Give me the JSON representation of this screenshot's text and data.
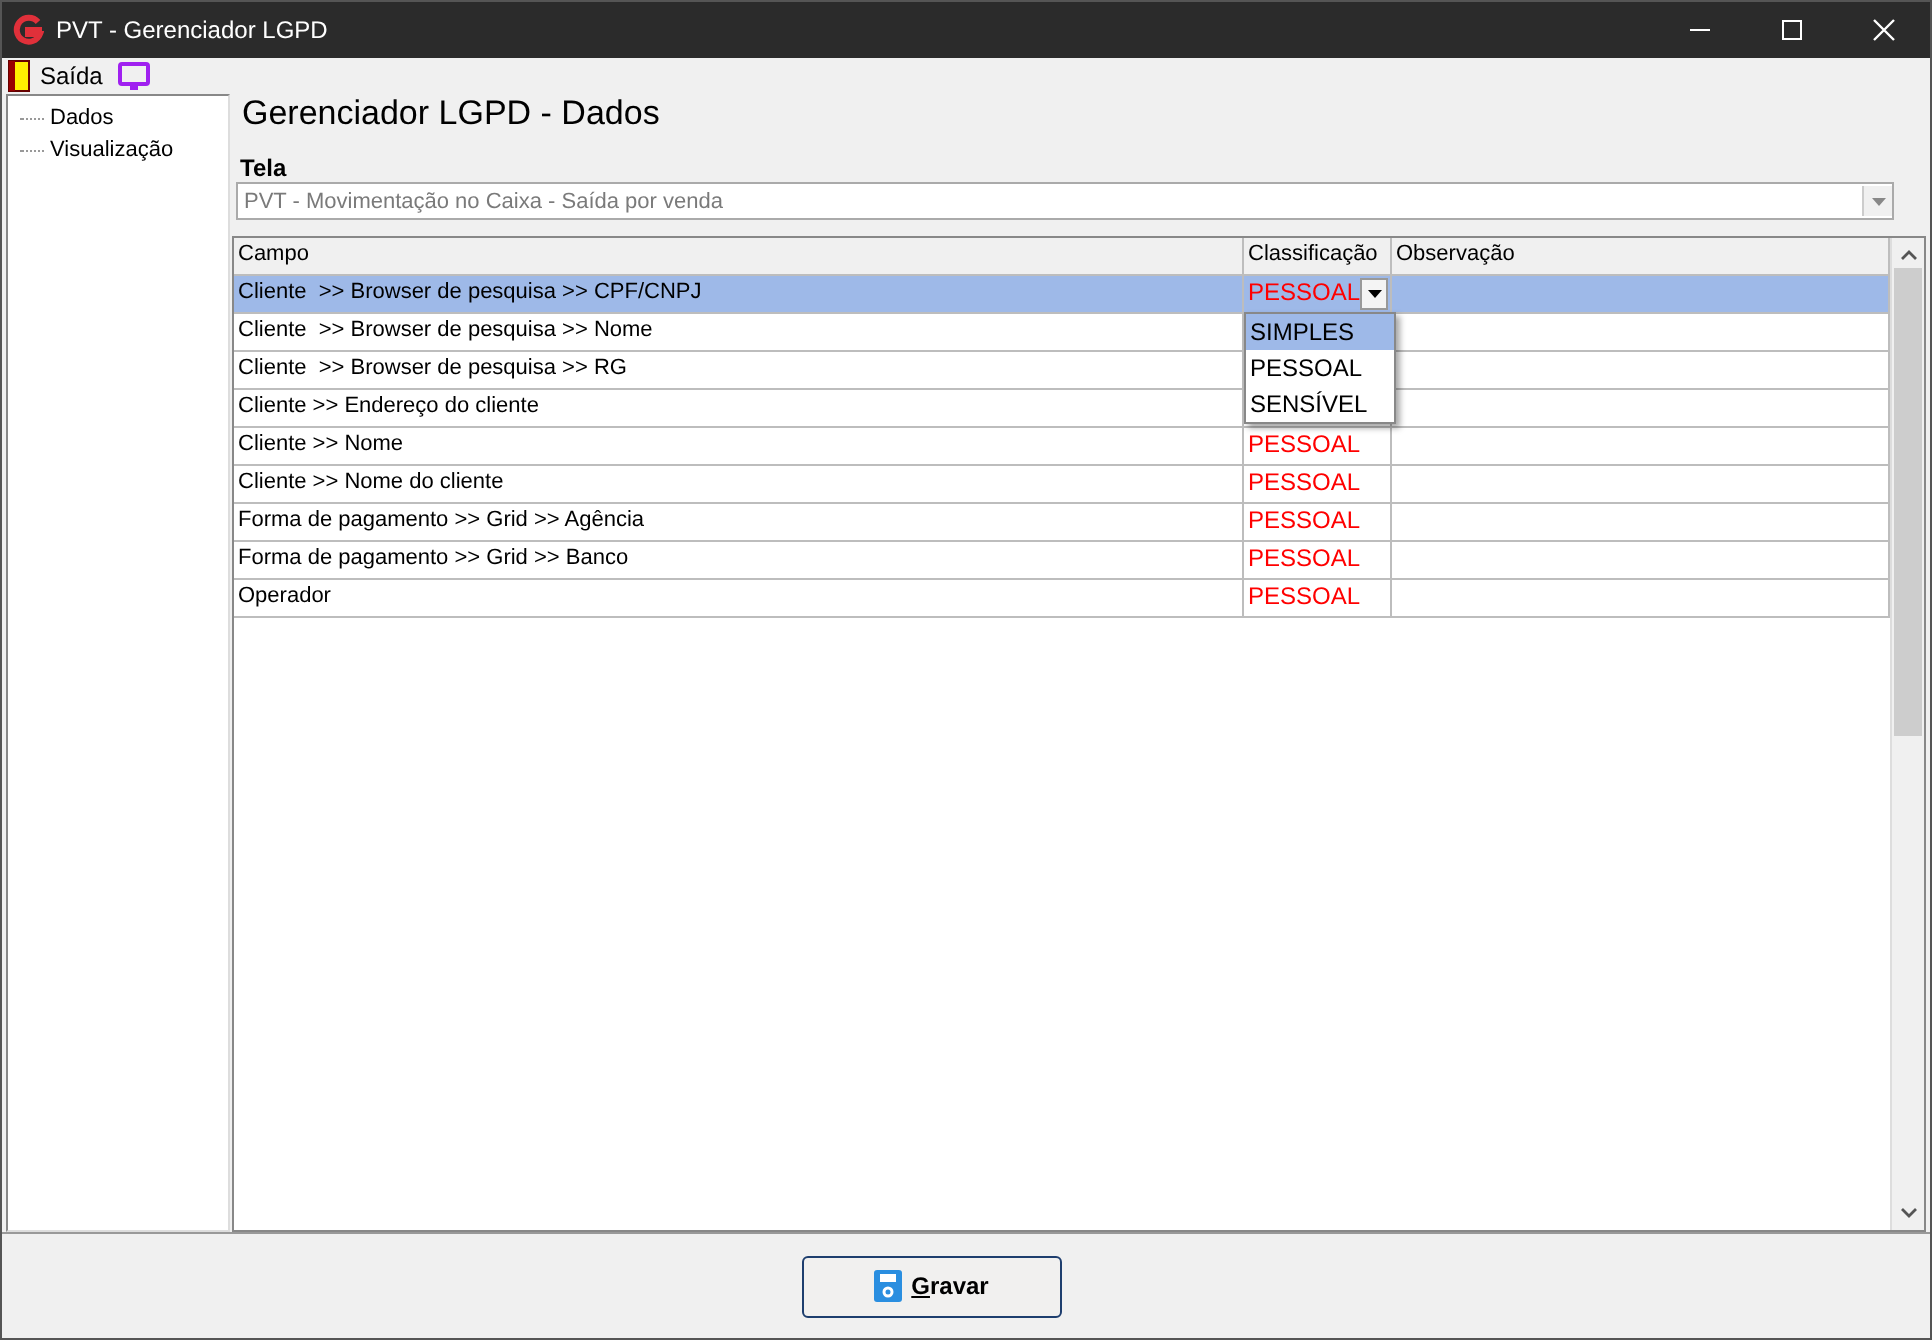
{
  "window": {
    "title": "PVT - Gerenciador LGPD"
  },
  "menu": [
    {
      "kind": "exit",
      "label": "Saída"
    },
    {
      "kind": "display"
    }
  ],
  "sidebar": {
    "items": [
      {
        "label": "Dados"
      },
      {
        "label": "Visualização"
      }
    ]
  },
  "heading": "Gerenciador LGPD - Dados",
  "screen_field": {
    "label": "Tela",
    "value": "PVT - Movimentação no Caixa - Saída por venda"
  },
  "table": {
    "columns": [
      "Campo",
      "Classificação",
      "Observação"
    ],
    "rows": [
      {
        "campo": "Cliente  >> Browser de pesquisa >> CPF/CNPJ",
        "classificacao": "PESSOAL",
        "selected": true
      },
      {
        "campo": "Cliente  >> Browser de pesquisa >> Nome",
        "selected": false
      },
      {
        "campo": "Cliente  >> Browser de pesquisa >> RG",
        "selected": false
      },
      {
        "campo": "Cliente >> Endereço do cliente",
        "selected": false
      },
      {
        "campo": "Cliente >> Nome",
        "classificacao": "PESSOAL",
        "selected": false
      },
      {
        "campo": "Cliente >> Nome do cliente",
        "classificacao": "PESSOAL",
        "selected": false
      },
      {
        "campo": "Forma de pagamento >> Grid >> Agência",
        "classificacao": "PESSOAL",
        "selected": false
      },
      {
        "campo": "Forma de pagamento >> Grid >> Banco",
        "classificacao": "PESSOAL",
        "selected": false
      },
      {
        "campo": "Operador",
        "classificacao": "PESSOAL",
        "selected": false
      }
    ],
    "dropdown": [
      {
        "label": "SIMPLES",
        "selected": true
      },
      {
        "label": "PESSOAL",
        "selected": false
      },
      {
        "label": "SENSÍVEL",
        "selected": false
      }
    ]
  },
  "save_button": {
    "label": "Gravar"
  }
}
